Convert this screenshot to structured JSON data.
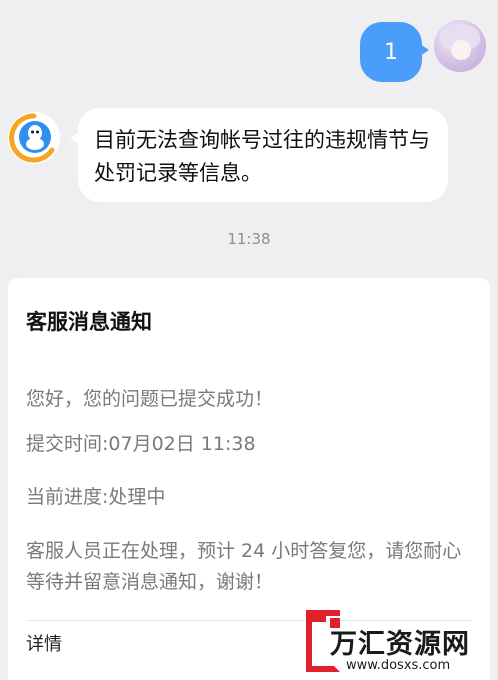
{
  "outgoing_message": {
    "text": "1"
  },
  "incoming_message": {
    "text": "目前无法查询帐号过往的违规情节与处罚记录等信息。"
  },
  "timestamp": "11:38",
  "notification_card": {
    "title": "客服消息通知",
    "greeting": "您好，您的问题已提交成功！",
    "submit_time": "提交时间:07月02日 11:38",
    "progress": "当前进度:处理中",
    "body": "客服人员正在处理，预计 24 小时答复您，请您耐心等待并留意消息通知，谢谢！",
    "detail_link": "详情"
  },
  "watermark": {
    "title": "万汇资源网",
    "url": "www.dosxs.com"
  },
  "colors": {
    "outgoing_bubble": "#4b9dfb",
    "background": "#efeff2",
    "card": "#ffffff",
    "watermark_accent": "#e0202a"
  },
  "icons": {
    "bot_avatar": "qq-logo-icon",
    "user_avatar": "anime-avatar"
  }
}
